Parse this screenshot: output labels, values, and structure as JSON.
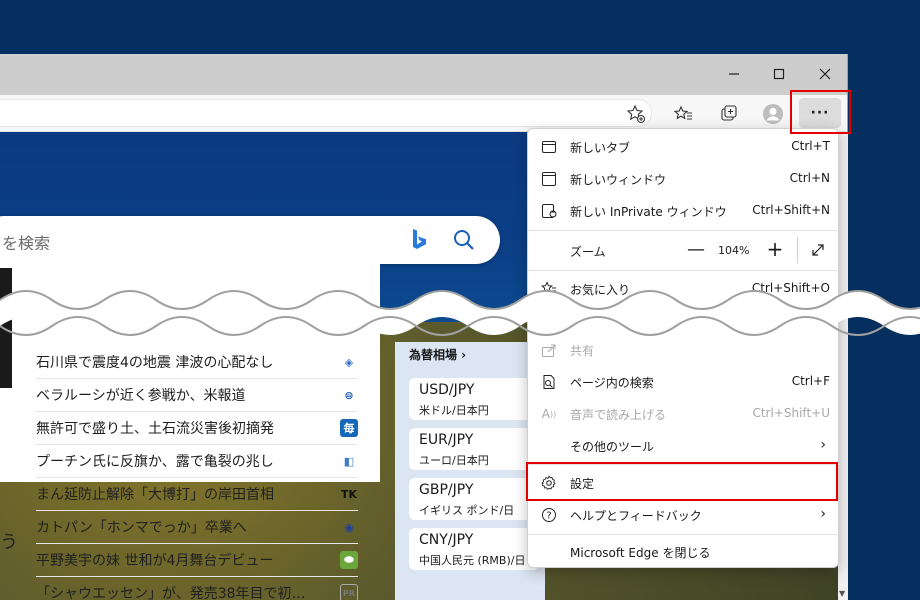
{
  "window": {
    "controls": {
      "minimize": "—",
      "maximize": "☐",
      "close": "✕"
    }
  },
  "toolbar": {
    "more_label": "···"
  },
  "search": {
    "placeholder": "を検索"
  },
  "news": {
    "items": [
      {
        "text": "石川県で震度4の地震 津波の心配なし",
        "logo": "◈",
        "logo_color": "#2f6fc9"
      },
      {
        "text": "ベラルーシが近く参戦か、米報道",
        "logo": "⊜",
        "logo_color": "#1f5fb5"
      },
      {
        "text": "無許可で盛り土、土石流災害後初摘発",
        "logo": "毎",
        "logo_color": "#1668b8"
      },
      {
        "text": "プーチン氏に反旗か、露で亀裂の兆し",
        "logo": "◧",
        "logo_color": "#3f7fbf"
      },
      {
        "text": "まん延防止解除「大博打」の岸田首相",
        "logo": "TK",
        "logo_color": "#111111"
      },
      {
        "text": "カトパン「ホンマでっか」卒業へ",
        "logo": "◉",
        "logo_color": "#1f3f9f"
      },
      {
        "text": "平野美宇の妹 世和が4月舞台デビュー",
        "logo": "⬬",
        "logo_color": "#6aa63a"
      },
      {
        "text": "「シャウエッセン」が、発売38年目で初…",
        "logo": "PR",
        "logo_color": "#777777"
      }
    ],
    "side_char": "う"
  },
  "fx": {
    "title": "為替相場 ›",
    "items": [
      {
        "code": "USD/JPY",
        "name": "米ドル/日本円"
      },
      {
        "code": "EUR/JPY",
        "name": "ユーロ/日本円"
      },
      {
        "code": "GBP/JPY",
        "name": "イギリス ポンド/日"
      },
      {
        "code": "CNY/JPY",
        "name": "中国人民元 (RMB)/日"
      }
    ]
  },
  "menu": {
    "new_tab": {
      "label": "新しいタブ",
      "shortcut": "Ctrl+T"
    },
    "new_window": {
      "label": "新しいウィンドウ",
      "shortcut": "Ctrl+N"
    },
    "new_private": {
      "label": "新しい InPrivate ウィンドウ",
      "shortcut": "Ctrl+Shift+N"
    },
    "zoom": {
      "label": "ズーム",
      "minus": "—",
      "value": "104%",
      "plus": "+"
    },
    "favorites": {
      "label": "お気に入り",
      "shortcut": "Ctrl+Shift+O"
    },
    "share": {
      "label": "共有"
    },
    "find": {
      "label": "ページ内の検索",
      "shortcut": "Ctrl+F"
    },
    "read_aloud": {
      "label": "音声で読み上げる",
      "shortcut": "Ctrl+Shift+U"
    },
    "more_tools": {
      "label": "その他のツール"
    },
    "settings": {
      "label": "設定"
    },
    "help": {
      "label": "ヘルプとフィードバック"
    },
    "close_edge": {
      "label": "Microsoft Edge を閉じる"
    }
  },
  "colors": {
    "highlight": "#e00000",
    "desktop": "#052f5e"
  }
}
